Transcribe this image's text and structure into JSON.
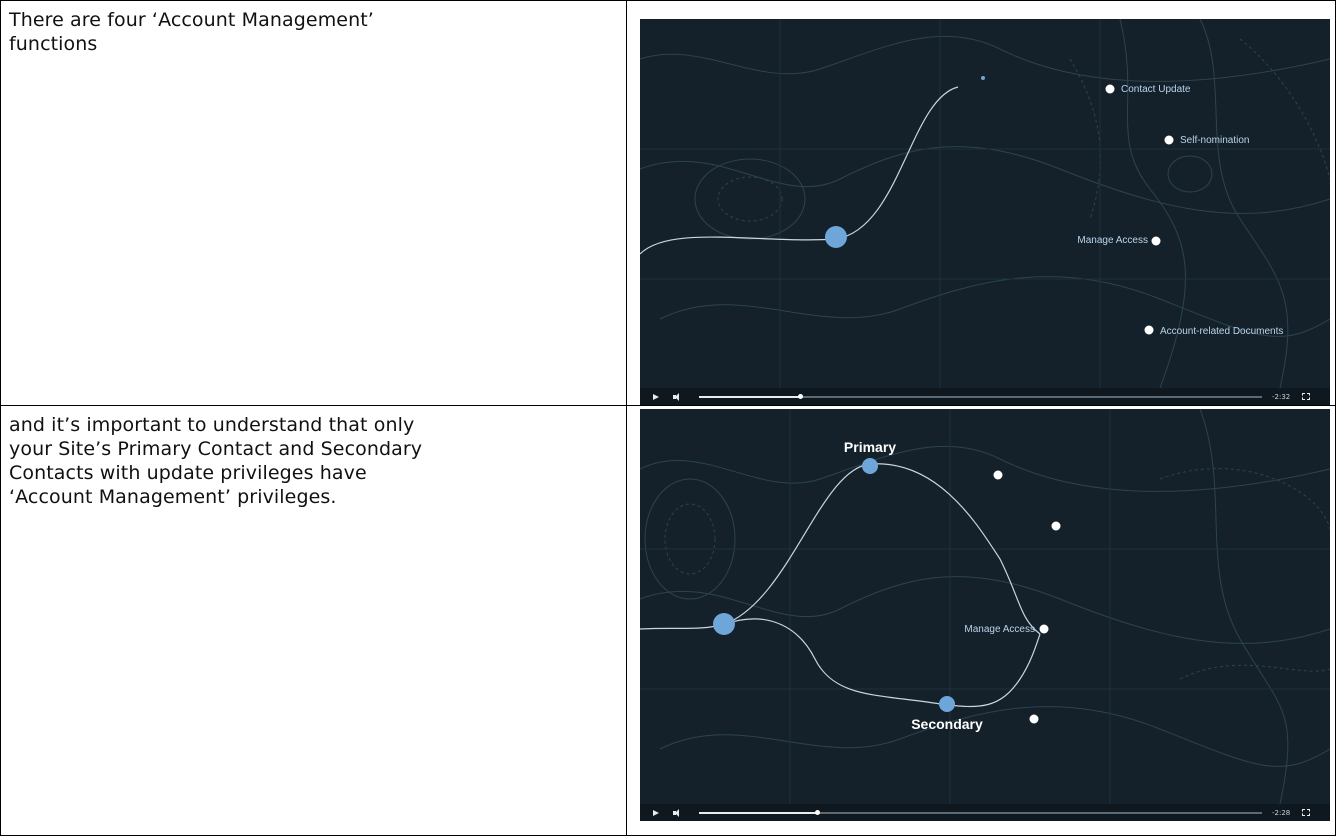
{
  "rows": [
    {
      "text": "There are four ‘Account Management’\nfunctions",
      "video": {
        "labels": [
          "Contact Update",
          "Self-nomination",
          "Manage Access",
          "Account-related Documents"
        ],
        "time": "-2:32",
        "progress": 0.18
      }
    },
    {
      "text": "and it’s important to understand that only\nyour Site’s Primary Contact and Secondary\nContacts with update privileges have\n‘Account Management’ privileges.",
      "video": {
        "labels": [
          "Primary",
          "Secondary",
          "Manage Access"
        ],
        "time": "-2:28",
        "progress": 0.21
      }
    }
  ],
  "icons": [
    "play-icon",
    "volume-icon",
    "fullscreen-icon"
  ],
  "colors": {
    "video_bg": "#14212a",
    "node_blue": "#6ea6d9",
    "line": "#c9d6df"
  }
}
